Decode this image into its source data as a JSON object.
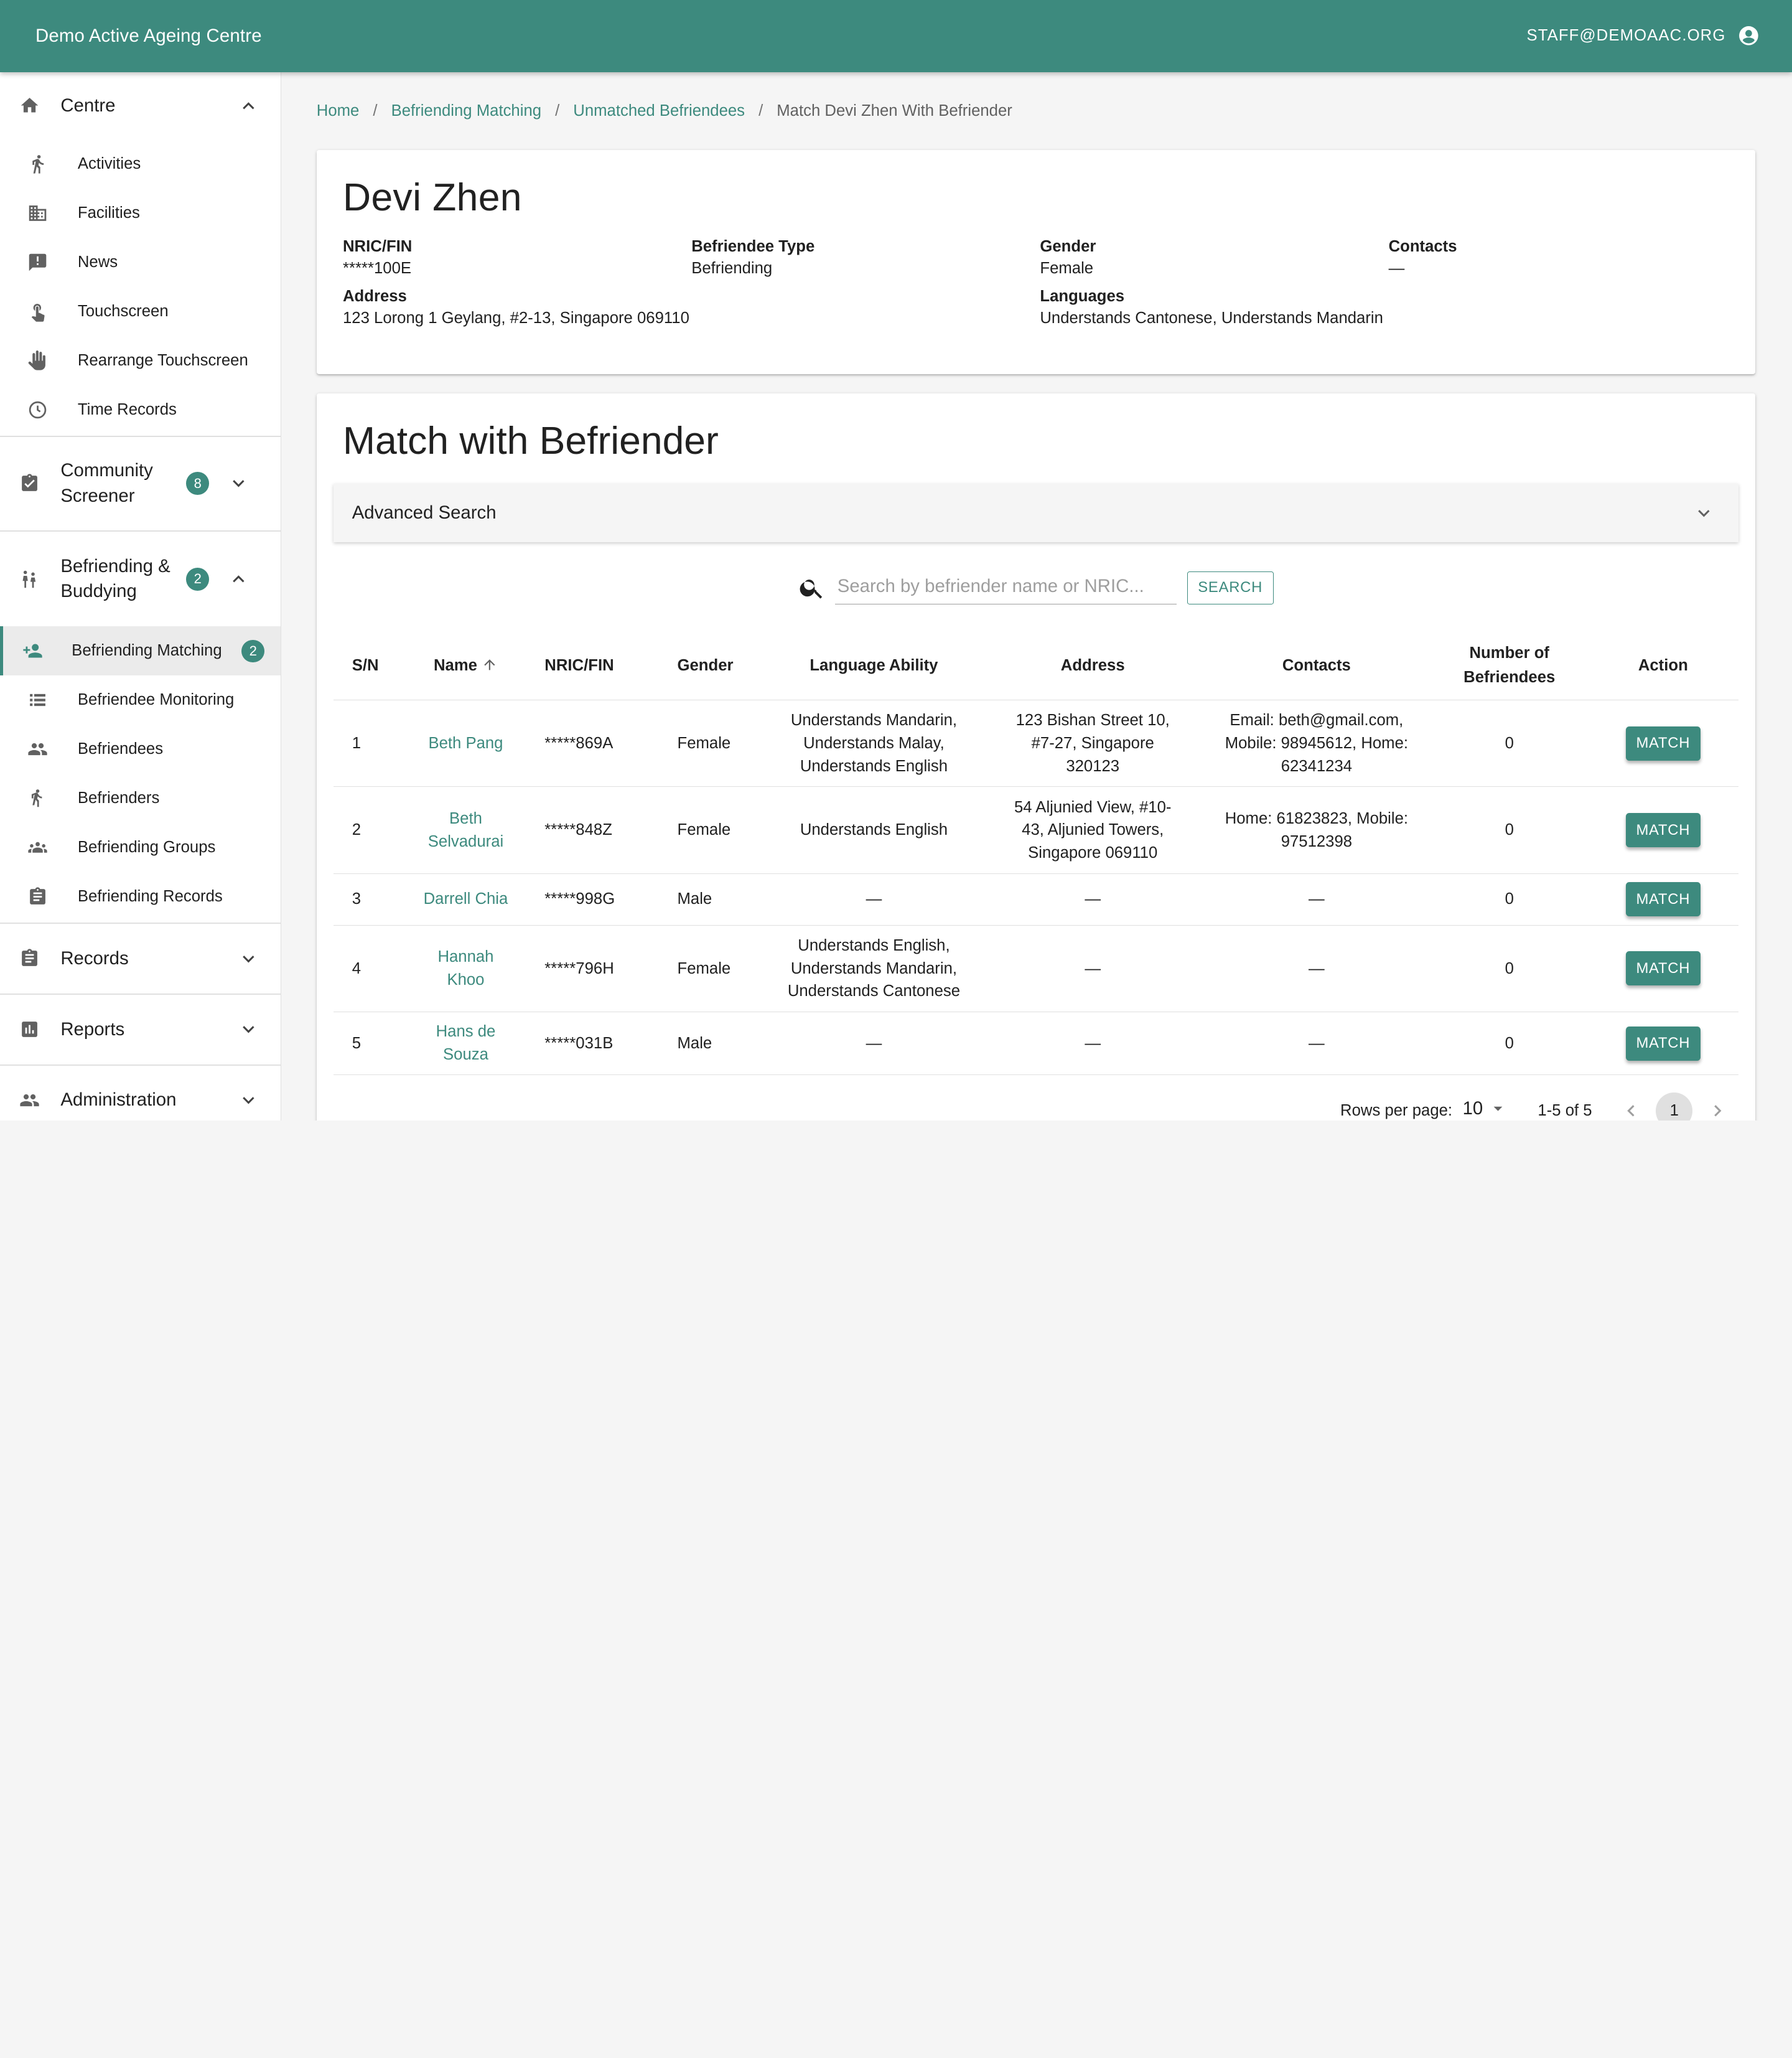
{
  "app": {
    "title": "Demo Active Ageing Centre",
    "user_email": "STAFF@DEMOAAC.ORG",
    "accent": "#3d8a7e"
  },
  "sidebar": {
    "centre": {
      "label": "Centre",
      "items": [
        {
          "label": "Activities",
          "icon": "running-icon"
        },
        {
          "label": "Facilities",
          "icon": "building-icon"
        },
        {
          "label": "News",
          "icon": "announcement-icon"
        },
        {
          "label": "Touchscreen",
          "icon": "touch-icon"
        },
        {
          "label": "Rearrange Touchscreen",
          "icon": "hand-icon"
        },
        {
          "label": "Time Records",
          "icon": "clock-icon"
        }
      ]
    },
    "community_screener": {
      "label": "Community Screener",
      "badge": "8"
    },
    "befriending": {
      "label": "Befriending & Buddying",
      "badge": "2",
      "items": [
        {
          "label": "Befriending Matching",
          "badge": "2"
        },
        {
          "label": "Befriendee Monitoring"
        },
        {
          "label": "Befriendees"
        },
        {
          "label": "Befrienders"
        },
        {
          "label": "Befriending Groups"
        },
        {
          "label": "Befriending Records"
        }
      ]
    },
    "records": {
      "label": "Records"
    },
    "reports": {
      "label": "Reports"
    },
    "administration": {
      "label": "Administration"
    }
  },
  "breadcrumb": {
    "home": "Home",
    "matching": "Befriending Matching",
    "unmatched": "Unmatched Befriendees",
    "current": "Match Devi Zhen With Befriender"
  },
  "profile": {
    "name": "Devi Zhen",
    "nric_label": "NRIC/FIN",
    "nric": "*****100E",
    "type_label": "Befriendee Type",
    "type": "Befriending",
    "gender_label": "Gender",
    "gender": "Female",
    "contacts_label": "Contacts",
    "contacts": "—",
    "address_label": "Address",
    "address": "123 Lorong 1 Geylang, #2-13, Singapore 069110",
    "languages_label": "Languages",
    "languages": "Understands Cantonese, Understands Mandarin"
  },
  "match": {
    "title": "Match with Befriender",
    "advanced_search": "Advanced Search",
    "search_placeholder": "Search by befriender name or NRIC...",
    "search_button": "SEARCH",
    "columns": {
      "sn": "S/N",
      "name": "Name",
      "nric": "NRIC/FIN",
      "gender": "Gender",
      "language": "Language Ability",
      "address": "Address",
      "contacts": "Contacts",
      "count": "Number of Befriendees",
      "action": "Action"
    },
    "match_label": "MATCH",
    "rows": [
      {
        "sn": "1",
        "name": "Beth Pang",
        "nric": "*****869A",
        "gender": "Female",
        "language": "Understands Mandarin, Understands Malay, Understands English",
        "address": "123 Bishan Street 10, #7-27, Singapore 320123",
        "contacts": "Email: beth@gmail.com, Mobile: 98945612, Home: 62341234",
        "count": "0"
      },
      {
        "sn": "2",
        "name": "Beth Selvadurai",
        "nric": "*****848Z",
        "gender": "Female",
        "language": "Understands English",
        "address": "54 Aljunied View, #10-43, Aljunied Towers, Singapore 069110",
        "contacts": "Home: 61823823, Mobile: 97512398",
        "count": "0"
      },
      {
        "sn": "3",
        "name": "Darrell Chia",
        "nric": "*****998G",
        "gender": "Male",
        "language": "—",
        "address": "—",
        "contacts": "—",
        "count": "0"
      },
      {
        "sn": "4",
        "name": "Hannah Khoo",
        "nric": "*****796H",
        "gender": "Female",
        "language": "Understands English, Understands Mandarin, Understands Cantonese",
        "address": "—",
        "contacts": "—",
        "count": "0"
      },
      {
        "sn": "5",
        "name": "Hans de Souza",
        "nric": "*****031B",
        "gender": "Male",
        "language": "—",
        "address": "—",
        "contacts": "—",
        "count": "0"
      }
    ]
  },
  "pagination": {
    "rows_per_page_label": "Rows per page:",
    "rows_per_page": "10",
    "range": "1-5 of 5",
    "page": "1"
  }
}
